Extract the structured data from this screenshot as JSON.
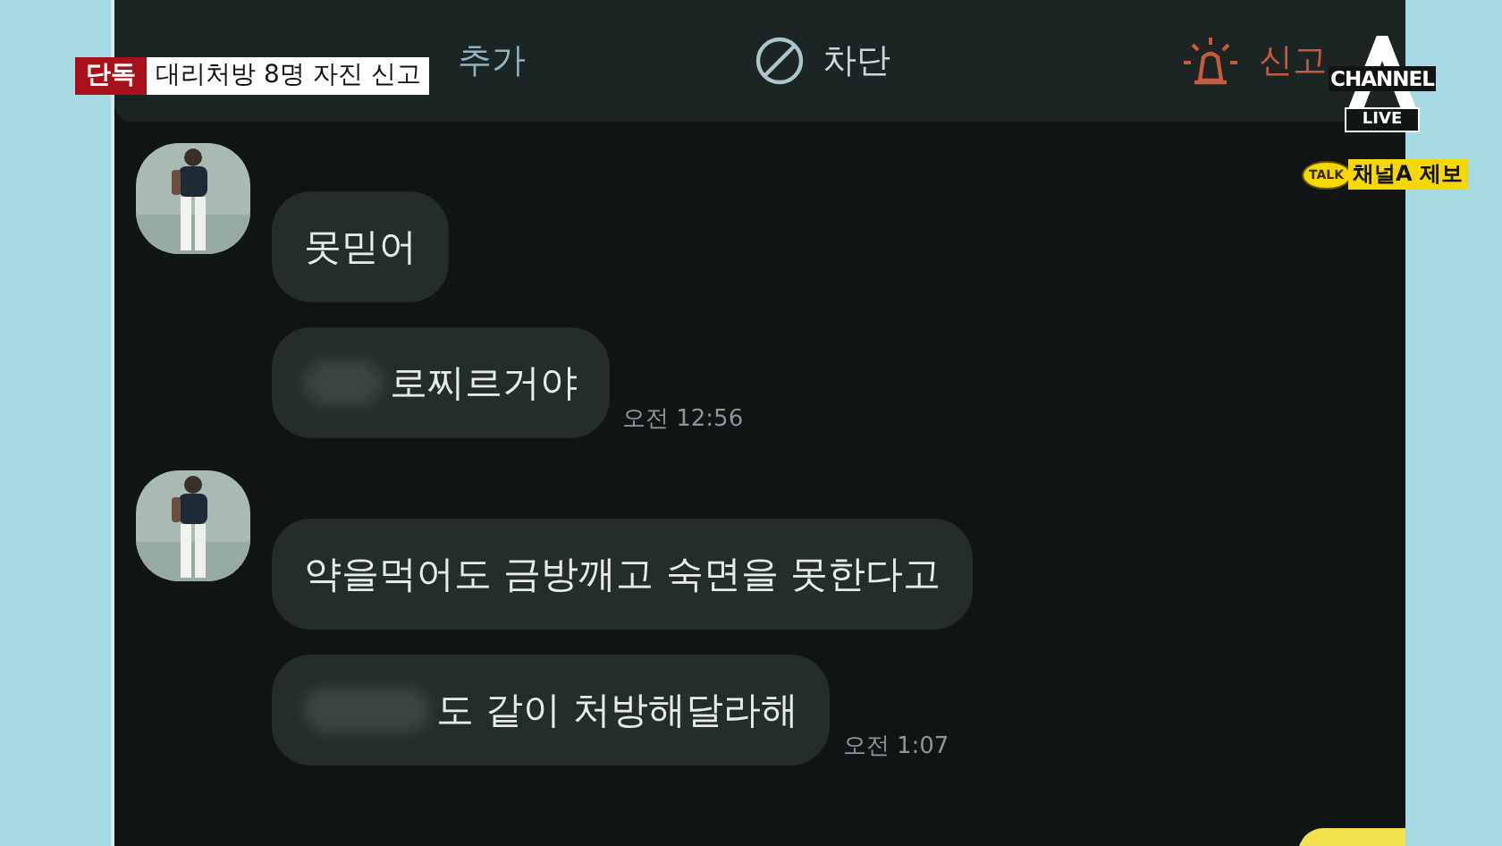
{
  "news_overlay": {
    "tag": "단독",
    "headline": "대리처방 8명 자진 신고"
  },
  "broadcaster": {
    "logo": "CHANNEL",
    "live": "LIVE",
    "tip_badge": "TALK",
    "tip_label": "채널A 제보"
  },
  "action_bar": [
    {
      "kind": "add",
      "label": "추가"
    },
    {
      "kind": "block",
      "label": "차단"
    },
    {
      "kind": "report",
      "label": "신고"
    }
  ],
  "message_groups": [
    {
      "avatar": {
        "kind": "picture"
      },
      "bubbles": [
        {
          "text": "못믿어",
          "kind": "plain"
        },
        {
          "text": "로찌르거야",
          "kind": "shortblur",
          "time": "오전 12:56"
        }
      ]
    },
    {
      "avatar": {
        "kind": "picture"
      },
      "bubbles": [
        {
          "text": "약을먹어도 금방깨고 숙면을 못한다고",
          "kind": "plain"
        },
        {
          "text": "도 같이 처방해달라해",
          "kind": "longblur",
          "time": "오전 1:07"
        }
      ]
    }
  ],
  "partial_sent_bubble": true
}
